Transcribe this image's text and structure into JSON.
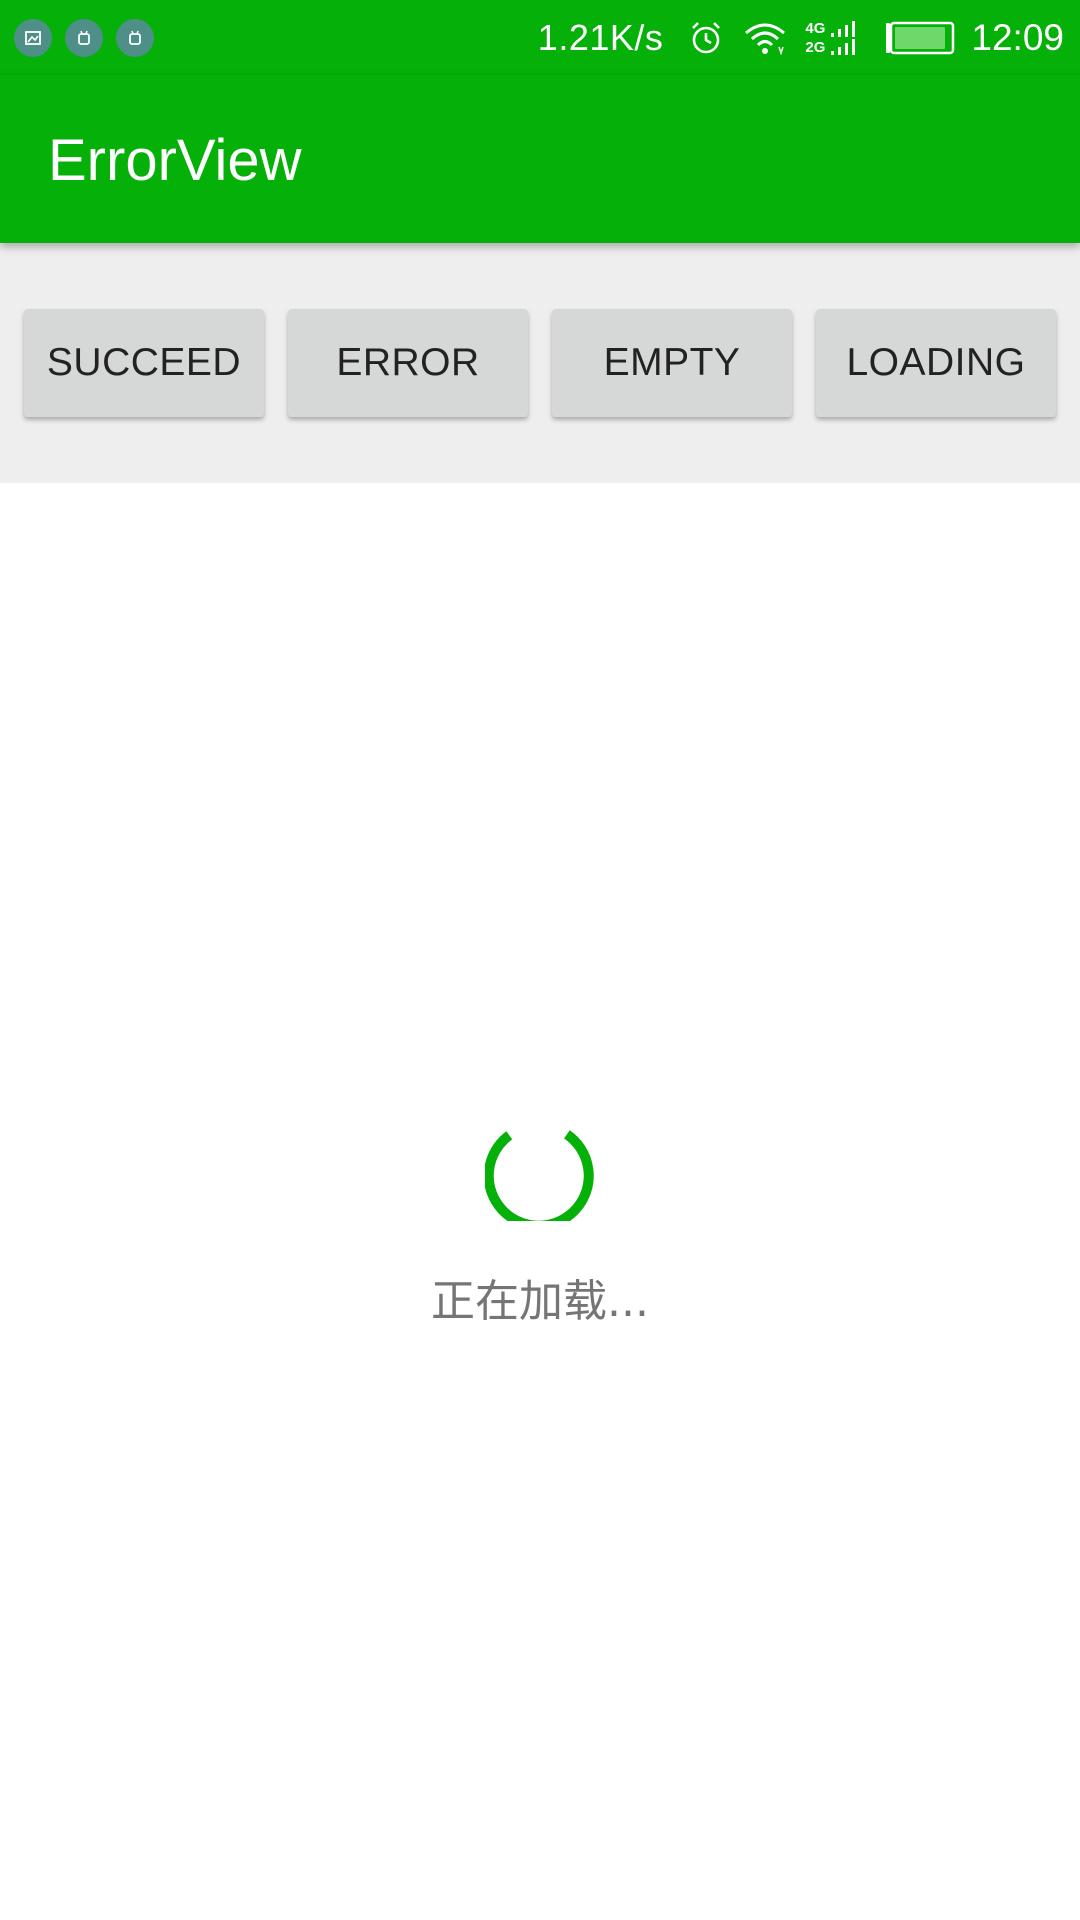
{
  "status_bar": {
    "net_speed": "1.21K/s",
    "network_type_top": "4G",
    "network_type_bottom": "2G",
    "time": "12:09",
    "battery_level": 0.9,
    "notification_icons": [
      "screenshot-icon",
      "android-icon",
      "android-icon"
    ]
  },
  "app_bar": {
    "title": "ErrorView"
  },
  "buttons": {
    "succeed": "SUCCEED",
    "error": "ERROR",
    "empty": "EMPTY",
    "loading": "LOADING"
  },
  "content": {
    "loading_text": "正在加载..."
  },
  "colors": {
    "primary": "#05b008",
    "spinner": "#05b008",
    "panel_bg": "#eeeeee",
    "button_bg": "#d6d7d7"
  }
}
